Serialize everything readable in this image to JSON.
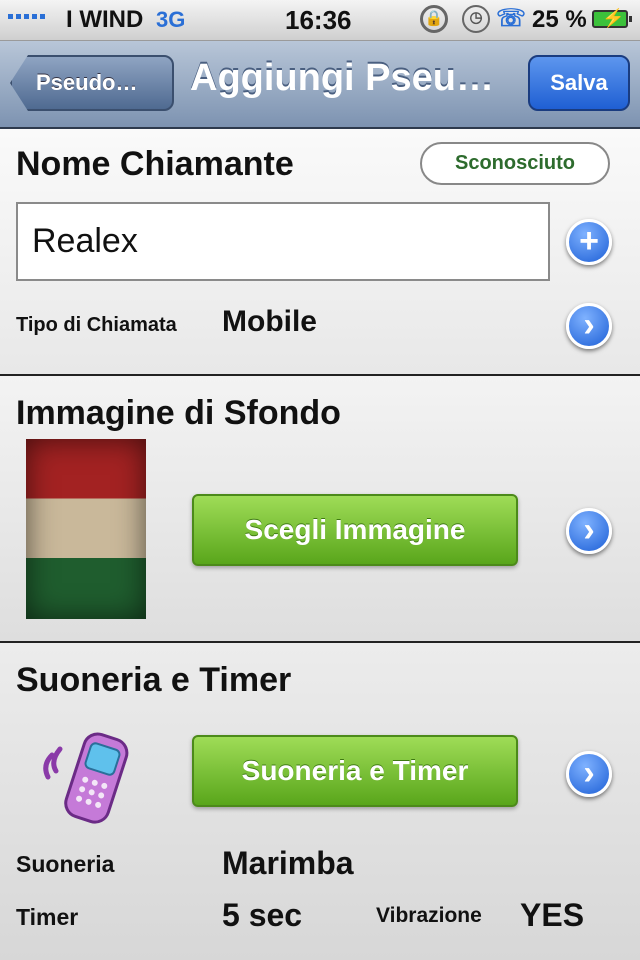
{
  "status_bar": {
    "carrier": "I WIND",
    "network": "3G",
    "time": "16:36",
    "battery": "25 %"
  },
  "nav": {
    "back_label": "Pseudo…",
    "title": "Aggiungi Pseu…",
    "save_label": "Salva"
  },
  "caller_section": {
    "title": "Nome Chiamante",
    "unknown_button": "Sconosciuto",
    "name_value": "Realex",
    "type_label": "Tipo di Chiamata",
    "type_value": "Mobile"
  },
  "background_section": {
    "title": "Immagine di Sfondo",
    "choose_button": "Scegli Immagine"
  },
  "ringtone_section": {
    "title": "Suoneria e Timer",
    "button": "Suoneria e Timer",
    "ringtone_label": "Suoneria",
    "ringtone_value": "Marimba",
    "timer_label": "Timer",
    "timer_value": "5 sec",
    "vibration_label": "Vibrazione",
    "vibration_value": "YES"
  },
  "icons": {
    "add": "plus-circle-icon",
    "disclosure": "chevron-right-circle-icon",
    "phone": "vibrating-phone-icon",
    "flag": "italian-flag-image"
  },
  "colors": {
    "nav_bar": "#8fa4c2",
    "save_button": "#1f5fd3",
    "green_button": "#6cb52a",
    "accent_blue": "#2a6fd6"
  }
}
